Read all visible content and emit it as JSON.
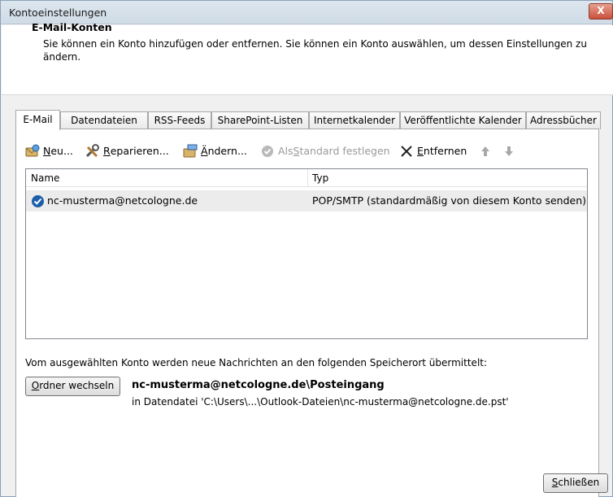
{
  "window": {
    "title": "Kontoeinstellungen",
    "close_label": "X"
  },
  "header": {
    "title": "E-Mail-Konten",
    "description": "Sie können ein Konto hinzufügen oder entfernen. Sie können ein Konto auswählen, um dessen Einstellungen zu ändern."
  },
  "tabs": [
    {
      "label": "E-Mail",
      "active": true
    },
    {
      "label": "Datendateien",
      "active": false
    },
    {
      "label": "RSS-Feeds",
      "active": false
    },
    {
      "label": "SharePoint-Listen",
      "active": false
    },
    {
      "label": "Internetkalender",
      "active": false
    },
    {
      "label": "Veröffentlichte Kalender",
      "active": false
    },
    {
      "label": "Adressbücher",
      "active": false
    }
  ],
  "toolbar": {
    "new": {
      "prefix": "",
      "accel": "N",
      "suffix": "eu...",
      "icon": "new-account-icon"
    },
    "repair": {
      "prefix": "",
      "accel": "R",
      "suffix": "eparieren...",
      "icon": "repair-tools-icon"
    },
    "change": {
      "prefix": "",
      "accel": "Ä",
      "suffix": "ndern...",
      "icon": "change-account-icon"
    },
    "set_default": {
      "prefix": "Als ",
      "accel": "S",
      "suffix": "tandard festlegen",
      "icon": "default-check-icon",
      "disabled": true
    },
    "remove": {
      "prefix": "",
      "accel": "E",
      "suffix": "ntfernen",
      "icon": "remove-x-icon"
    },
    "move_up_icon": "arrow-up-icon",
    "move_down_icon": "arrow-down-icon"
  },
  "accounts_table": {
    "columns": [
      "Name",
      "Typ"
    ],
    "rows": [
      {
        "name": "nc-musterma@netcologne.de",
        "type": "POP/SMTP (standardmäßig von diesem Konto senden)",
        "default": true
      }
    ]
  },
  "delivery": {
    "info": "Vom ausgewählten Konto werden neue Nachrichten an den folgenden Speicherort übermittelt:",
    "change_folder_accel": "O",
    "change_folder_suffix": "rdner wechseln",
    "folder_path": "nc-musterma@netcologne.de\\Posteingang",
    "data_file": "in Datendatei 'C:\\Users\\...\\Outlook-Dateien\\nc-musterma@netcologne.de.pst'"
  },
  "footer": {
    "close_accel": "S",
    "close_suffix": "chließen"
  },
  "colors": {
    "accent": "#1d5ea8",
    "close_button": "#c9503a",
    "selected_row": "#ececec"
  }
}
